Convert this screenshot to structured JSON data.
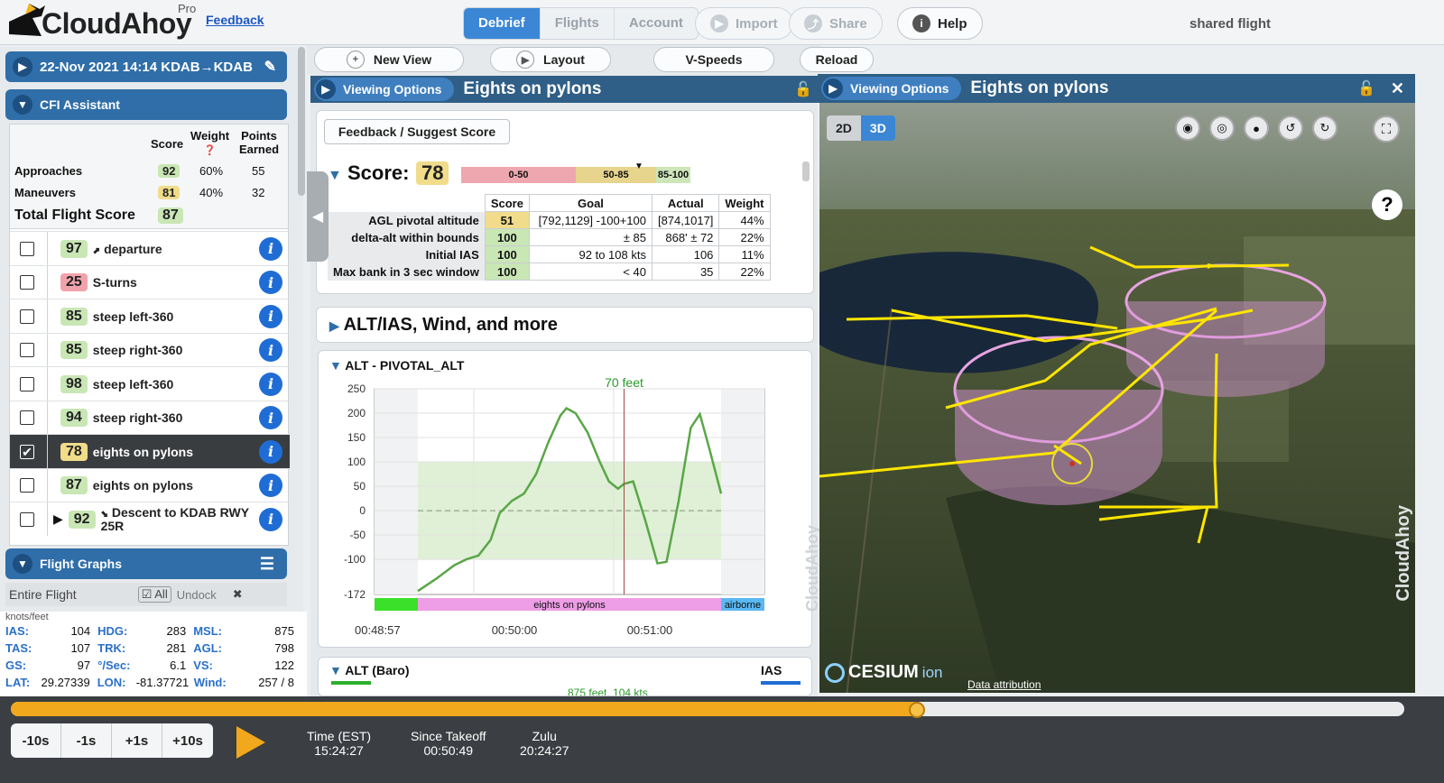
{
  "header": {
    "logo": "CloudAhoy",
    "tier": "Pro",
    "feedback": "Feedback",
    "tabs": [
      "Debrief",
      "Flights",
      "Account"
    ],
    "import": "Import",
    "share": "Share",
    "help": "Help",
    "shared": "shared flight"
  },
  "flight": {
    "label": "22-Nov 2021 14:14  KDAB→KDAB"
  },
  "cfi": {
    "title": "CFI Assistant",
    "col_score": "Score",
    "col_weight": "Weight",
    "col_points": "Points Earned",
    "rows": [
      {
        "name": "Approaches",
        "score": "92",
        "weight": "60%",
        "points": "55"
      },
      {
        "name": "Maneuvers",
        "score": "81",
        "weight": "40%",
        "points": "32"
      }
    ],
    "total_label": "Total Flight Score",
    "total": "87",
    "items": [
      {
        "score": "97",
        "label": "departure",
        "prefix": "⬈",
        "color": "g"
      },
      {
        "score": "25",
        "label": "S-turns",
        "color": "r"
      },
      {
        "score": "85",
        "label": "steep left-360",
        "color": "g"
      },
      {
        "score": "85",
        "label": "steep right-360",
        "color": "g"
      },
      {
        "score": "98",
        "label": "steep left-360",
        "color": "g"
      },
      {
        "score": "94",
        "label": "steep right-360",
        "color": "g"
      },
      {
        "score": "78",
        "label": "eights on pylons",
        "color": "y",
        "selected": true
      },
      {
        "score": "87",
        "label": "eights on pylons",
        "color": "g"
      },
      {
        "score": "92",
        "label": "Descent to KDAB RWY 25R",
        "prefix": "⬊",
        "color": "g"
      }
    ]
  },
  "graphs": {
    "title": "Flight Graphs",
    "entire": "Entire Flight",
    "all": "All",
    "undock": "Undock",
    "units": "knots/feet",
    "alt_baro": "ALT (Baro)",
    "telemetry": [
      [
        "IAS:",
        "104",
        "HDG:",
        "283",
        "MSL:",
        "875"
      ],
      [
        "TAS:",
        "107",
        "TRK:",
        "281",
        "AGL:",
        "798"
      ],
      [
        "GS:",
        "97",
        "°/Sec:",
        "6.1",
        "VS:",
        "122"
      ],
      [
        "LAT:",
        "29.27339",
        "LON:",
        "-81.37721",
        "Wind:",
        "257 / 8"
      ]
    ]
  },
  "toolbar": {
    "new_view": "New View",
    "layout": "Layout",
    "vspeeds": "V-Speeds",
    "reload": "Reload"
  },
  "center": {
    "viewing": "Viewing Options",
    "title": "Eights on pylons",
    "feedback_btn": "Feedback / Suggest Score",
    "score_label": "Score:",
    "score": "78",
    "bands": [
      "0-50",
      "50-85",
      "85-100"
    ],
    "table_head": [
      "Score",
      "Goal",
      "Actual",
      "Weight"
    ],
    "table": [
      [
        "AGL pivotal altitude",
        "51",
        "[792,1129] -100+100",
        "[874,1017]",
        "44%"
      ],
      [
        "delta-alt within bounds",
        "100",
        "± 85",
        "868' ± 72",
        "22%"
      ],
      [
        "Initial IAS",
        "100",
        "92 to 108 kts",
        "106",
        "11%"
      ],
      [
        "Max bank in 3 sec window",
        "100",
        "< 40",
        "35",
        "22%"
      ]
    ],
    "alt_ias": "ALT/IAS, Wind, and more",
    "chart_title": "ALT - PIVOTAL_ALT",
    "marker": "70 feet",
    "bottom_labels": [
      "eights on pylons",
      "airborne"
    ],
    "times": [
      "00:48:57",
      "00:50:00",
      "00:51:00"
    ],
    "alt_baro": "ALT (Baro)",
    "ias": "IAS",
    "overlay": "875 feet, 104 kts",
    "watermark": "CloudAhoy"
  },
  "map": {
    "viewing": "Viewing Options",
    "title": "Eights on pylons",
    "mode2d": "2D",
    "mode3d": "3D",
    "cesium": "CESIUM",
    "ion": "ion",
    "attribution": "Data attribution",
    "watermark": "CloudAhoy",
    "help": "?"
  },
  "playback": {
    "buttons": [
      "-10s",
      "-1s",
      "+1s",
      "+10s"
    ],
    "progress": 0.65,
    "time_est_label": "Time (EST)",
    "time_est": "15:24:27",
    "since_label": "Since Takeoff",
    "since": "00:50:49",
    "zulu_label": "Zulu",
    "zulu": "20:24:27"
  },
  "chart_data": {
    "type": "line",
    "title": "ALT - PIVOTAL_ALT",
    "y_ticks": [
      250,
      200,
      150,
      100,
      50,
      0,
      -50,
      -100,
      -172
    ],
    "x_ticks": [
      "00:48:57",
      "00:50:00",
      "00:51:00"
    ],
    "ylim": [
      -172,
      250
    ],
    "annotation": "70 feet",
    "series": [
      {
        "values": [
          [
            0,
            -165
          ],
          [
            0.06,
            -140
          ],
          [
            0.12,
            -112
          ],
          [
            0.16,
            -100
          ],
          [
            0.2,
            -92
          ],
          [
            0.24,
            -60
          ],
          [
            0.27,
            -5
          ],
          [
            0.31,
            20
          ],
          [
            0.35,
            35
          ],
          [
            0.39,
            75
          ],
          [
            0.43,
            140
          ],
          [
            0.47,
            195
          ],
          [
            0.49,
            210
          ],
          [
            0.52,
            200
          ],
          [
            0.56,
            160
          ],
          [
            0.6,
            100
          ],
          [
            0.63,
            60
          ],
          [
            0.66,
            45
          ],
          [
            0.68,
            55
          ],
          [
            0.71,
            60
          ],
          [
            0.75,
            -20
          ],
          [
            0.79,
            -108
          ],
          [
            0.82,
            -105
          ],
          [
            0.86,
            20
          ],
          [
            0.9,
            170
          ],
          [
            0.93,
            198
          ],
          [
            0.96,
            130
          ],
          [
            1.0,
            35
          ]
        ]
      }
    ]
  }
}
